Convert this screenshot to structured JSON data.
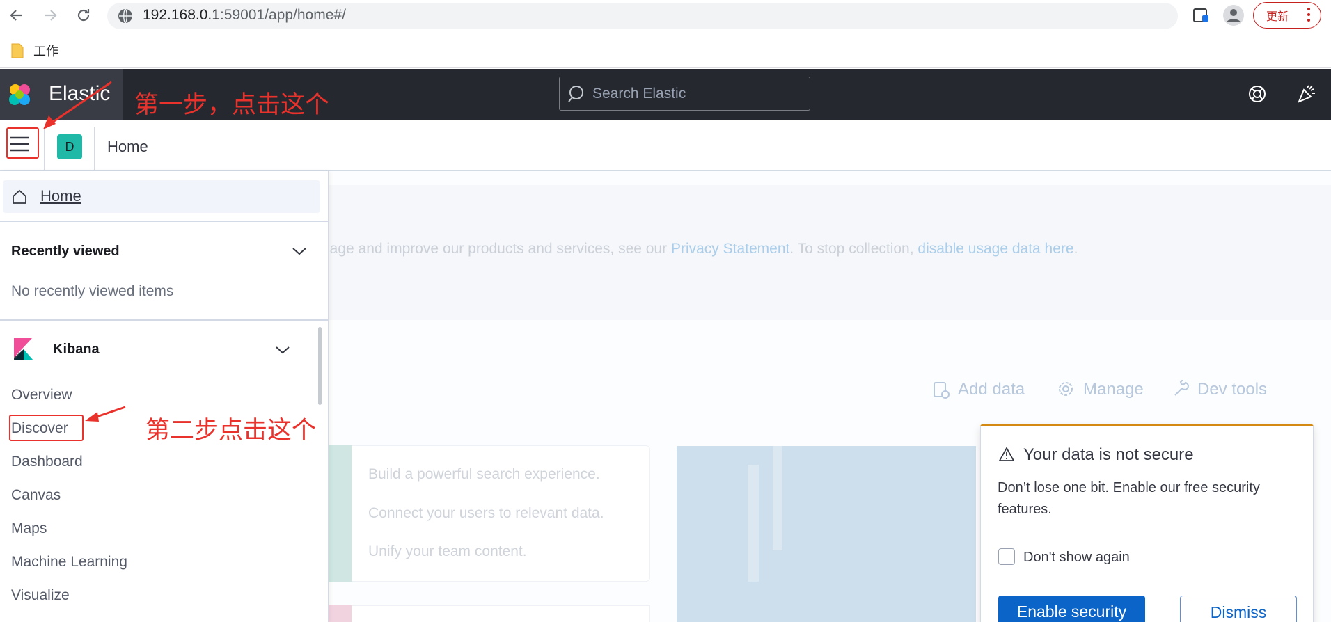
{
  "browser": {
    "url_host": "192.168.0.1",
    "url_rest": ":59001/app/home#/",
    "update_label": "更新",
    "bookmark_folder": "工作"
  },
  "header": {
    "brand": "Elastic",
    "search_placeholder": "Search Elastic"
  },
  "subheader": {
    "space_initial": "D",
    "breadcrumb": "Home"
  },
  "sidenav": {
    "home_label": "Home",
    "recently_viewed_title": "Recently viewed",
    "recently_viewed_empty": "No recently viewed items",
    "kibana_title": "Kibana",
    "kibana_links": [
      "Overview",
      "Discover",
      "Dashboard",
      "Canvas",
      "Maps",
      "Machine Learning",
      "Visualize"
    ]
  },
  "main": {
    "notice_prefix": "nage and improve our products and services, see our ",
    "notice_link1": "Privacy Statement",
    "notice_middle": ". To stop collection, ",
    "notice_link2": "disable usage data here",
    "notice_suffix": ".",
    "quick_links": [
      "Add data",
      "Manage",
      "Dev tools"
    ],
    "card_lines": [
      "Build a powerful search experience.",
      "Connect your users to relevant data.",
      "Unify your team content."
    ]
  },
  "toast": {
    "title": "Your data is not secure",
    "body": "Don’t lose one bit. Enable our free security features.",
    "checkbox_label": "Don't show again",
    "enable_label": "Enable security",
    "dismiss_label": "Dismiss"
  },
  "annotations": {
    "step1": "第一步，点击这个",
    "step2": "第二步点击这个"
  }
}
